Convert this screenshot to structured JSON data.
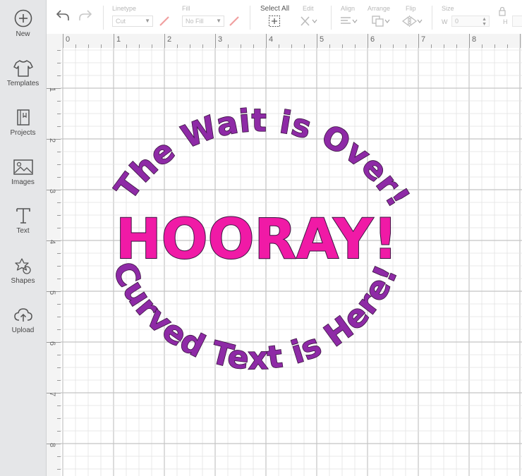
{
  "sidebar": {
    "items": [
      {
        "label": "New",
        "icon": "plus-circle-icon"
      },
      {
        "label": "Templates",
        "icon": "tshirt-icon"
      },
      {
        "label": "Projects",
        "icon": "notebook-icon"
      },
      {
        "label": "Images",
        "icon": "image-icon"
      },
      {
        "label": "Text",
        "icon": "text-t-icon"
      },
      {
        "label": "Shapes",
        "icon": "shapes-icon"
      },
      {
        "label": "Upload",
        "icon": "cloud-upload-icon"
      }
    ]
  },
  "toolbar": {
    "linetype_label": "Linetype",
    "linetype_value": "Cut",
    "fill_label": "Fill",
    "fill_value": "No Fill",
    "select_all_label": "Select All",
    "edit_label": "Edit",
    "align_label": "Align",
    "arrange_label": "Arrange",
    "flip_label": "Flip",
    "size_label": "Size",
    "width_label": "W",
    "width_value": "0",
    "height_label": "H"
  },
  "ruler": {
    "top": [
      "0",
      "1",
      "2",
      "3",
      "4",
      "5",
      "6",
      "7",
      "8"
    ],
    "left": [
      "1",
      "2",
      "3",
      "4",
      "5",
      "6",
      "7",
      "8"
    ]
  },
  "design": {
    "top_arc_text": "The Wait is Over!!",
    "center_text": "HOORAY!",
    "bottom_arc_text": "Curved Text is Here!",
    "arc_color": "#8e2aa6",
    "center_color": "#f01aa6",
    "outline_color": "#3a1440"
  }
}
